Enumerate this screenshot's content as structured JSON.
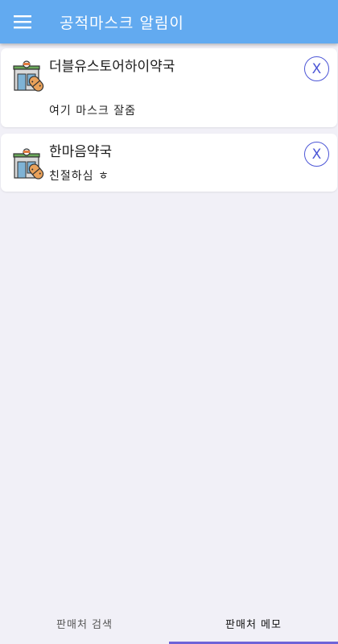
{
  "app": {
    "title": "공적마스크 알림이",
    "menu_icon": "hamburger-menu-icon",
    "header_color": "#62aaf0"
  },
  "stores": [
    {
      "name": "더블유스토어하이약국",
      "memo": "여기 마스크 잘줌",
      "icon": "pharmacy-store-icon",
      "delete_label": "X"
    },
    {
      "name": "한마음약국",
      "memo": "친절하심 ㅎ",
      "icon": "pharmacy-store-icon",
      "delete_label": "X"
    }
  ],
  "bottom_nav": {
    "tabs": [
      {
        "label": "판매처 검색",
        "active": false
      },
      {
        "label": "판매처 메모",
        "active": true
      }
    ],
    "indicator_color": "#6e63d8"
  }
}
